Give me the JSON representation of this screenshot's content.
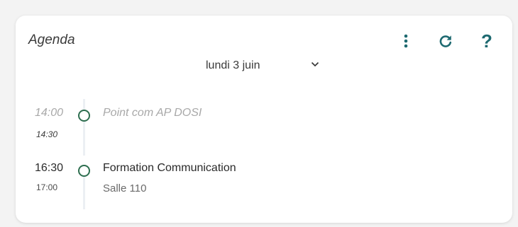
{
  "widget": {
    "title": "Agenda",
    "date_label": "lundi 3 juin",
    "icons": {
      "menu": "more-vertical-icon",
      "refresh": "refresh-icon",
      "help": "?",
      "date_dropdown": "chevron-down-icon"
    },
    "colors": {
      "accent": "#1d6970",
      "dot": "#2d6e4f",
      "timeline": "#eceff3"
    }
  },
  "events": [
    {
      "start": "14:00",
      "end": "14:30",
      "title": "Point com AP DOSI",
      "location": "",
      "state": "past"
    },
    {
      "start": "16:30",
      "end": "17:00",
      "title": "Formation Communication",
      "location": "Salle 110",
      "state": "current"
    }
  ]
}
